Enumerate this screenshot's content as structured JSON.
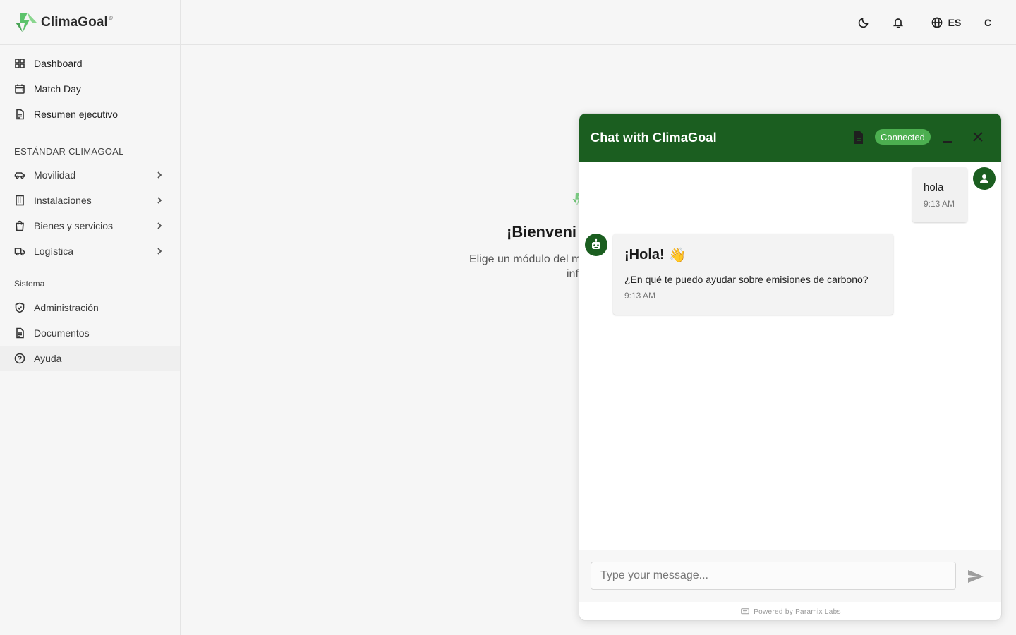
{
  "brand": {
    "name": "ClimaGoal",
    "reg": "®"
  },
  "sidebar": {
    "top_items": [
      {
        "label": "Dashboard",
        "icon": "dashboard-grid-icon"
      },
      {
        "label": "Match Day",
        "icon": "calendar-icon"
      },
      {
        "label": "Resumen ejecutivo",
        "icon": "document-icon"
      }
    ],
    "standard_title": "ESTÁNDAR CLIMAGOAL",
    "standard_items": [
      {
        "label": "Movilidad",
        "icon": "car-icon"
      },
      {
        "label": "Instalaciones",
        "icon": "building-icon"
      },
      {
        "label": "Bienes y servicios",
        "icon": "shopping-bag-icon"
      },
      {
        "label": "Logística",
        "icon": "truck-icon"
      }
    ],
    "system_title": "Sistema",
    "system_items": [
      {
        "label": "Administración",
        "icon": "shield-icon"
      },
      {
        "label": "Documentos",
        "icon": "document-icon"
      },
      {
        "label": "Ayuda",
        "icon": "help-circle-icon"
      }
    ]
  },
  "topbar": {
    "language": "ES",
    "user_initial": "C"
  },
  "welcome": {
    "title": "¡Bienveni",
    "subtitle": "Elige un módulo del m",
    "subtitle2": "inf"
  },
  "chat": {
    "title": "Chat with ClimaGoal",
    "status": "Connected",
    "messages": {
      "user": {
        "text": "hola",
        "time": "9:13 AM"
      },
      "bot": {
        "greeting": "¡Hola!",
        "wave": "👋",
        "text": "¿En qué te puedo ayudar sobre emisiones de carbono?",
        "time": "9:13 AM"
      }
    },
    "input_placeholder": "Type your message...",
    "footer": "Powered by Paramix Labs"
  },
  "colors": {
    "primary": "#1b5e20",
    "badge": "#4caf50",
    "logo_green": "#5cc36b"
  }
}
